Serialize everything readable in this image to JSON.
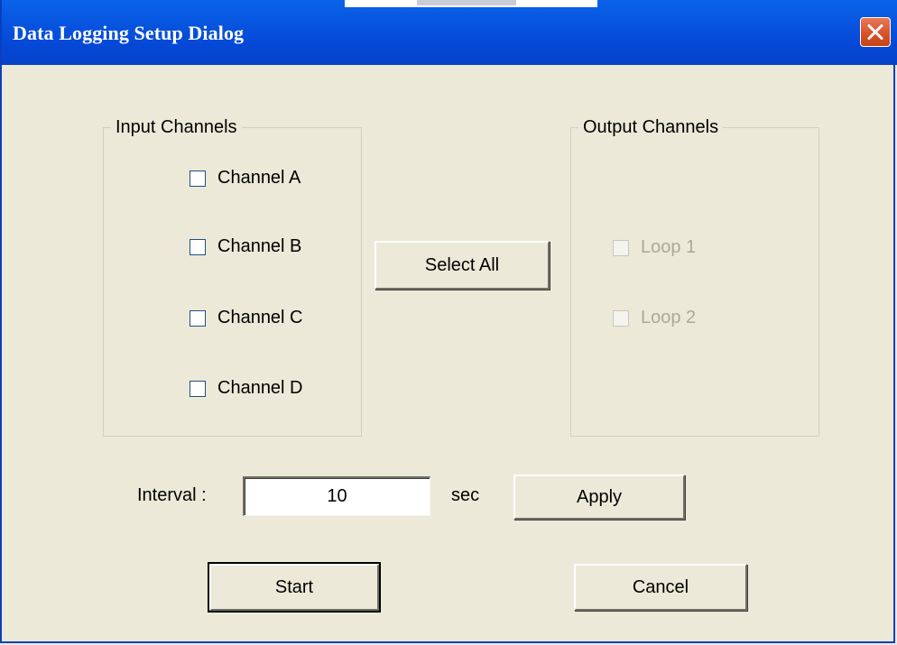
{
  "window": {
    "title": "Data Logging Setup Dialog",
    "close_icon": "close-x-icon"
  },
  "input_channels": {
    "legend": "Input Channels",
    "items": [
      {
        "label": "Channel A",
        "checked": false
      },
      {
        "label": "Channel B",
        "checked": false
      },
      {
        "label": "Channel C",
        "checked": false
      },
      {
        "label": "Channel D",
        "checked": false
      }
    ]
  },
  "output_channels": {
    "legend": "Output Channels",
    "items": [
      {
        "label": "Loop 1",
        "checked": false,
        "enabled": false
      },
      {
        "label": "Loop 2",
        "checked": false,
        "enabled": false
      }
    ]
  },
  "select_all_label": "Select All",
  "interval": {
    "label": "Interval :",
    "value": "10",
    "unit": "sec",
    "apply_label": "Apply"
  },
  "buttons": {
    "start_label": "Start",
    "cancel_label": "Cancel"
  },
  "colors": {
    "titlebar": "#0548d6",
    "dialog_bg": "#ece9d8",
    "close_button": "#d8532a",
    "disabled_text": "#aca899"
  }
}
